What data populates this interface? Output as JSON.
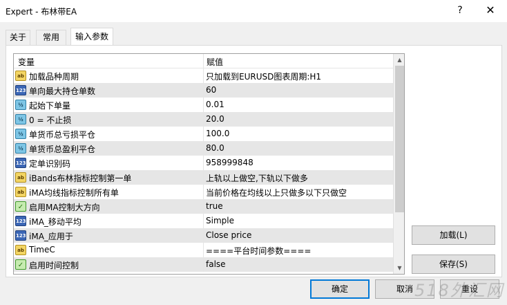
{
  "window": {
    "title": "Expert - 布林带EA",
    "help_glyph": "?",
    "close_glyph": "✕"
  },
  "tabs": [
    {
      "label": "关于"
    },
    {
      "label": "常用"
    },
    {
      "label": "输入参数"
    }
  ],
  "grid": {
    "col_variable": "变量",
    "col_value": "赋值",
    "rows": [
      {
        "type": "ab",
        "icon": "string-icon",
        "name": "加载品种周期",
        "value": "只加载到EURUSD图表周期:H1"
      },
      {
        "type": "int",
        "icon": "integer-icon",
        "name": "单向最大持仓单数",
        "value": "60"
      },
      {
        "type": "dbl",
        "icon": "double-icon",
        "name": "起始下单量",
        "value": "0.01"
      },
      {
        "type": "dbl",
        "icon": "double-icon",
        "name": "0 = 不止损",
        "value": "20.0"
      },
      {
        "type": "dbl",
        "icon": "double-icon",
        "name": "单货币总亏损平仓",
        "value": "100.0"
      },
      {
        "type": "dbl",
        "icon": "double-icon",
        "name": "单货币总盈利平仓",
        "value": "80.0"
      },
      {
        "type": "int",
        "icon": "integer-icon",
        "name": "定单识别码",
        "value": "958999848"
      },
      {
        "type": "ab",
        "icon": "string-icon",
        "name": "iBands布林指标控制第一单",
        "value": "上轨以上做空,下轨以下做多"
      },
      {
        "type": "ab",
        "icon": "string-icon",
        "name": "iMA均线指标控制所有单",
        "value": "当前价格在均线以上只做多以下只做空"
      },
      {
        "type": "bool",
        "icon": "boolean-icon",
        "name": "启用MA控制大方向",
        "value": "true"
      },
      {
        "type": "int",
        "icon": "enum-icon",
        "name": "iMA_移动平均",
        "value": "Simple"
      },
      {
        "type": "int",
        "icon": "enum-icon",
        "name": "iMA_应用于",
        "value": "Close price"
      },
      {
        "type": "ab",
        "icon": "string-icon",
        "name": "TimeC",
        "value": "====平台时间参数===="
      },
      {
        "type": "bool",
        "icon": "boolean-icon",
        "name": "启用时间控制",
        "value": "false"
      }
    ]
  },
  "icon_glyphs": {
    "ab": "ab",
    "int": "123",
    "dbl": "½",
    "bool": "✓"
  },
  "buttons": {
    "load": "加载(L)",
    "save": "保存(S)",
    "ok": "确定",
    "cancel": "取消",
    "reset": "重设"
  },
  "watermark": "518外汇网"
}
